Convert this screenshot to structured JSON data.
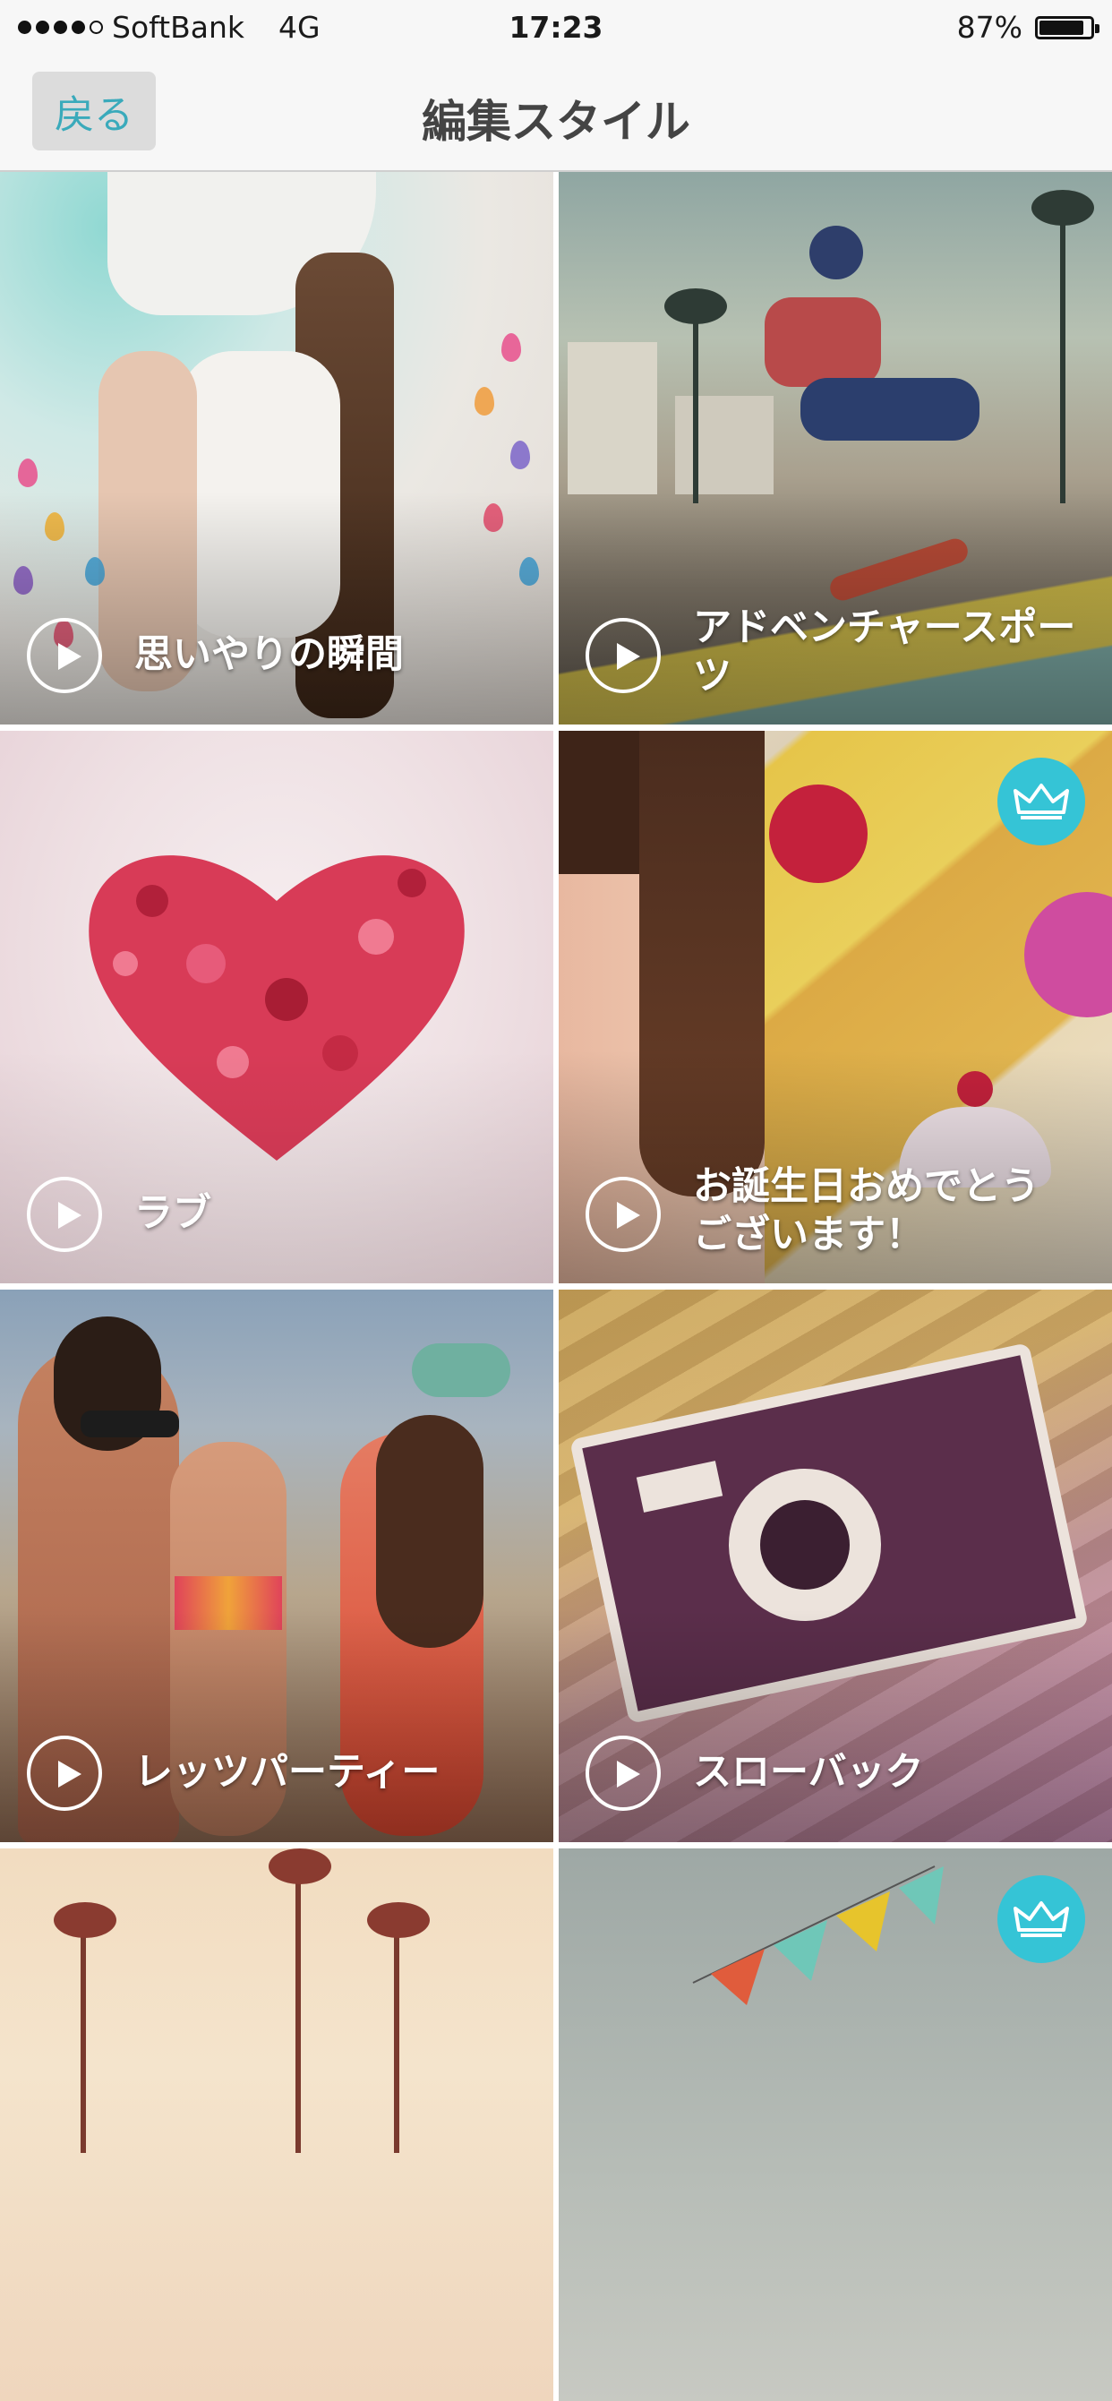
{
  "status_bar": {
    "carrier": "SoftBank",
    "network": "4G",
    "time": "17:23",
    "battery": "87%",
    "battery_level": 0.87
  },
  "nav": {
    "back_label": "戻る",
    "title": "編集スタイル"
  },
  "styles": [
    {
      "label": "思いやりの瞬間",
      "premium": false
    },
    {
      "label": "アドベンチャースポーツ",
      "premium": false
    },
    {
      "label": "ラブ",
      "premium": false
    },
    {
      "label": "お誕生日おめでとうございます！",
      "premium": true
    },
    {
      "label": "レッツパーティー",
      "premium": false
    },
    {
      "label": "スローバック",
      "premium": false
    },
    {
      "label": "",
      "premium": false
    },
    {
      "label": "",
      "premium": true
    }
  ],
  "colors": {
    "accent": "#35c4d6",
    "back_text": "#3aaabb",
    "nav_bg": "#f7f7f7"
  }
}
